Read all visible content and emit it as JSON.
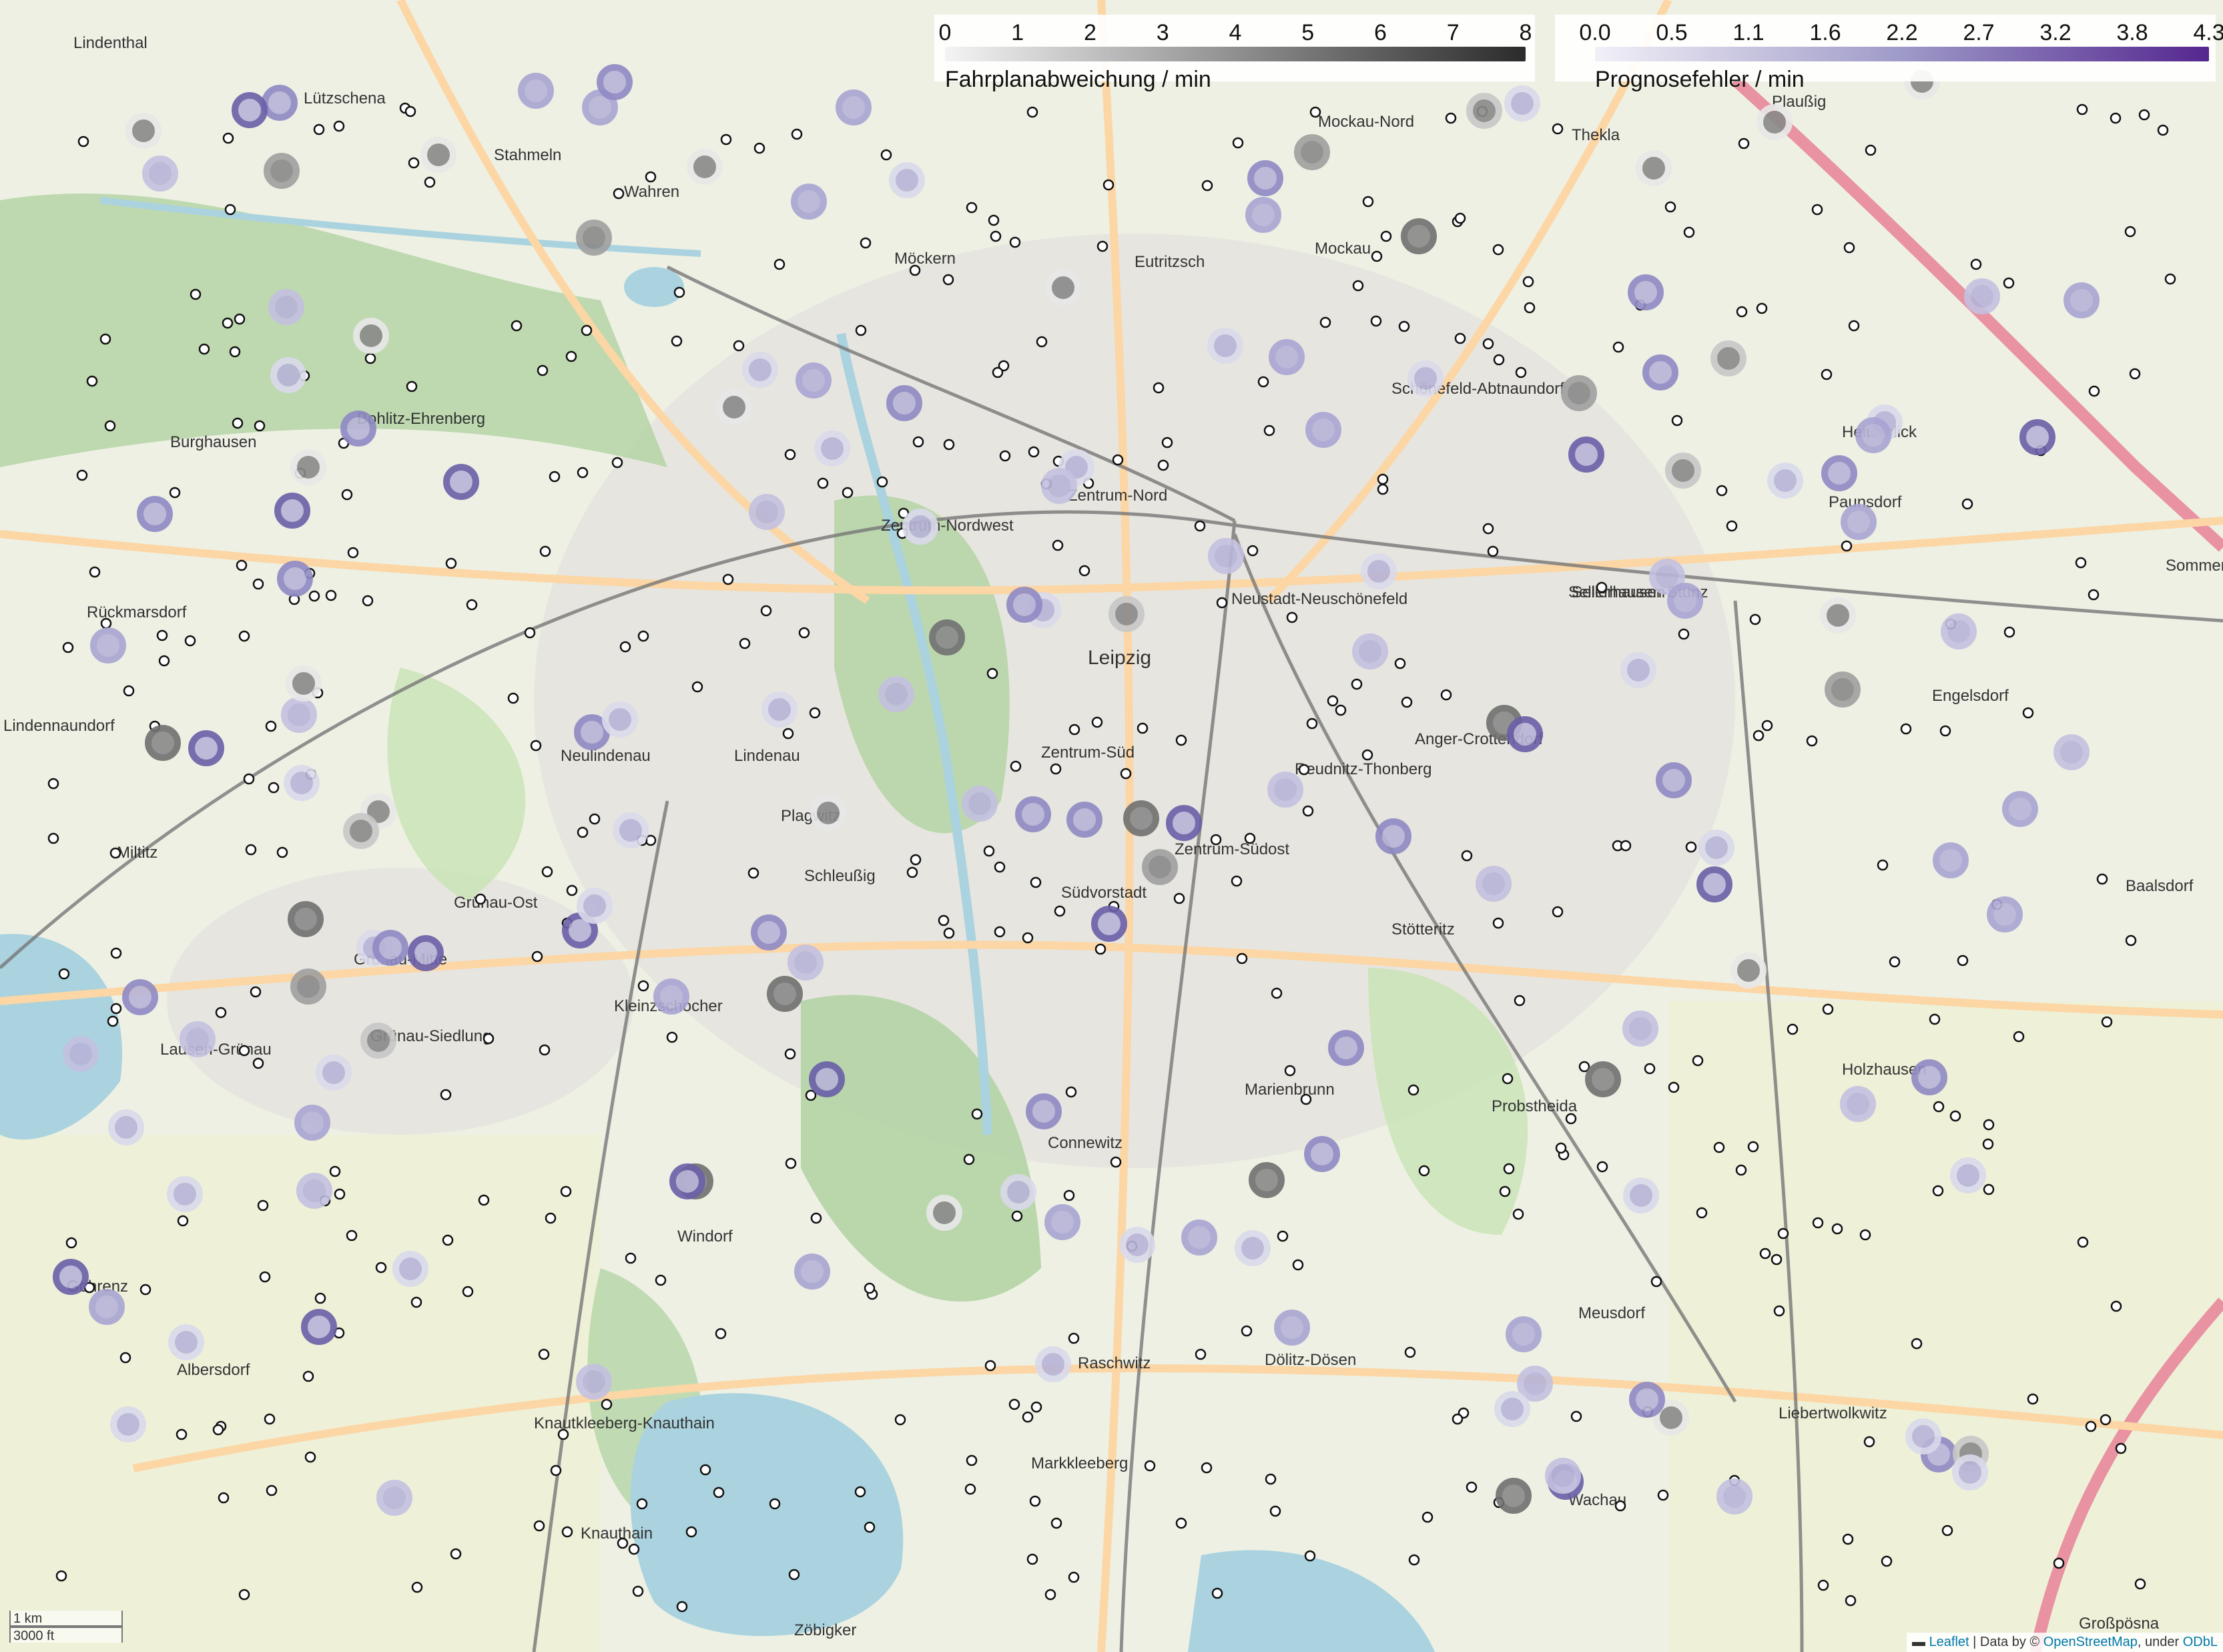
{
  "legend_schedule": {
    "title": "Fahrplanabweichung / min",
    "ticks": [
      "0",
      "1",
      "2",
      "3",
      "4",
      "5",
      "6",
      "7",
      "8"
    ]
  },
  "legend_forecast": {
    "title": "Prognosefehler / min",
    "ticks": [
      "0.0",
      "0.5",
      "1.1",
      "1.6",
      "2.2",
      "2.7",
      "3.2",
      "3.8",
      "4.3"
    ]
  },
  "scale": {
    "metric": "1 km",
    "imperial": "3000 ft"
  },
  "attribution": {
    "leaflet": "Leaflet",
    "sep": " | Data by © ",
    "osm": "OpenStreetMap",
    "under": ", under ",
    "odbl": "ODbL"
  },
  "places": [
    {
      "name": "Möckern"
    },
    {
      "name": "Eutritzsch"
    },
    {
      "name": "Mockau-Nord"
    },
    {
      "name": "Mockau"
    },
    {
      "name": "Zentrum-Nordwest"
    },
    {
      "name": "Zentrum-Nord"
    },
    {
      "name": "Zentrum-Süd"
    },
    {
      "name": "Zentrum-Südost"
    },
    {
      "name": "Leipzig"
    },
    {
      "name": "Lindenau"
    },
    {
      "name": "Neulindenau"
    },
    {
      "name": "Plagwitz"
    },
    {
      "name": "Schleußig"
    },
    {
      "name": "Südvorstadt"
    },
    {
      "name": "Connewitz"
    },
    {
      "name": "Marienbrunn"
    },
    {
      "name": "Grünau-Ost"
    },
    {
      "name": "Grünau-Mitte"
    },
    {
      "name": "Grünau-Siedlung"
    },
    {
      "name": "Lausen-Grünau"
    },
    {
      "name": "Miltitz"
    },
    {
      "name": "Burghausen"
    },
    {
      "name": "Bohlitz-Ehrenberg"
    },
    {
      "name": "Rückmarsdorf"
    },
    {
      "name": "Kleinzschocher"
    },
    {
      "name": "Windorf"
    },
    {
      "name": "Göhrenz"
    },
    {
      "name": "Albersdorf"
    },
    {
      "name": "Knautkleeberg-Knauthain"
    },
    {
      "name": "Knauthain"
    },
    {
      "name": "Raschwitz"
    },
    {
      "name": "Dölitz-Dösen"
    },
    {
      "name": "Meusdorf"
    },
    {
      "name": "Wachau"
    },
    {
      "name": "Liebertwolkwitz"
    },
    {
      "name": "Holzhausen"
    },
    {
      "name": "Probstheida"
    },
    {
      "name": "Stötteritz"
    },
    {
      "name": "Reudnitz-Thonberg"
    },
    {
      "name": "Anger-Crottendorf"
    },
    {
      "name": "Sellerhausen-Stünz"
    },
    {
      "name": "Paunsdorf"
    },
    {
      "name": "Heiterblick"
    },
    {
      "name": "Sommerfeld"
    },
    {
      "name": "Engelsdorf"
    },
    {
      "name": "Baalsdorf"
    },
    {
      "name": "Schönefeld-Abtnaundorf"
    },
    {
      "name": "Plaußig"
    },
    {
      "name": "Thekla"
    },
    {
      "name": "Wahren"
    },
    {
      "name": "Lützschena"
    },
    {
      "name": "Stahmeln"
    },
    {
      "name": "Lindenthal"
    },
    {
      "name": "Markkleeberg"
    },
    {
      "name": "Zöbigker"
    },
    {
      "name": "Großpösna"
    },
    {
      "name": "Neustadt-Neuschönefeld"
    },
    {
      "name": "Lindennaundorf"
    },
    {
      "name": "Sellerhausen"
    }
  ],
  "colors": {
    "schedule_low": "#f0f0f0",
    "schedule_high": "#2b2b2b",
    "forecast_low": "#f2f0f7",
    "forecast_high": "#54278f",
    "water": "#aad3df",
    "park": "#c8e4b4",
    "motorway": "#e892a2",
    "primary_road": "#fcd6a4"
  }
}
